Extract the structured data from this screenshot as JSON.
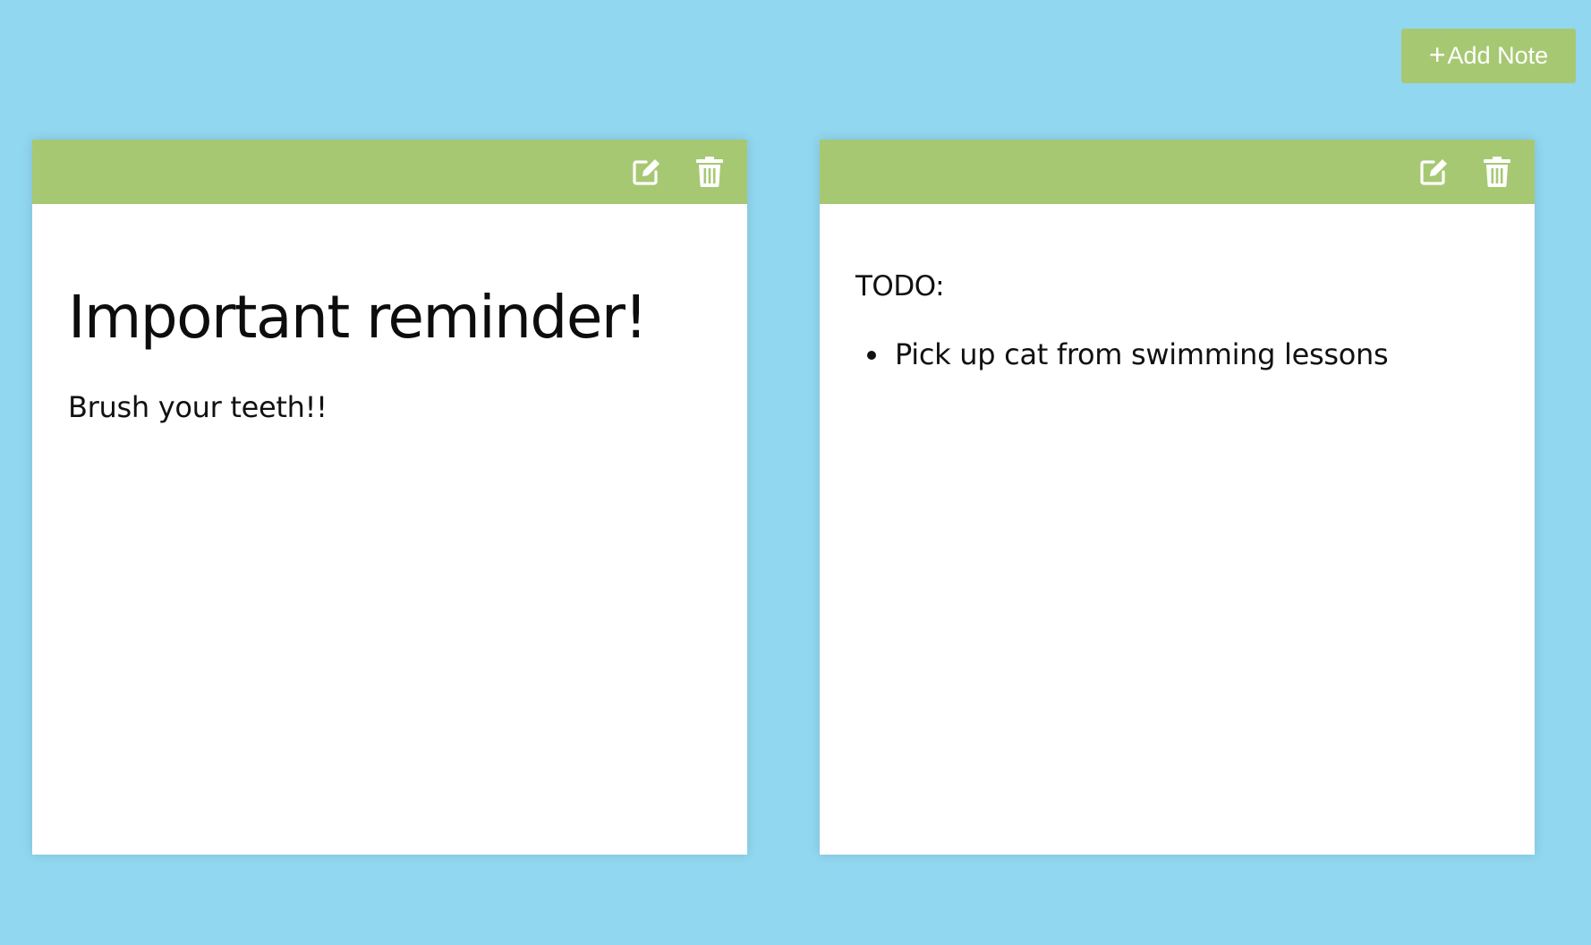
{
  "header": {
    "add_note_icon": "+",
    "add_note_label": "Add Note"
  },
  "icons": {
    "edit": "edit-icon",
    "delete": "trash-icon"
  },
  "colors": {
    "background": "#91d7f0",
    "accent": "#a7c873",
    "note_bg": "#ffffff"
  },
  "notes": [
    {
      "title": "Important reminder!",
      "text": "Brush your teeth!!"
    },
    {
      "label": "TODO:",
      "items": [
        "Pick up cat from swimming lessons"
      ]
    }
  ]
}
